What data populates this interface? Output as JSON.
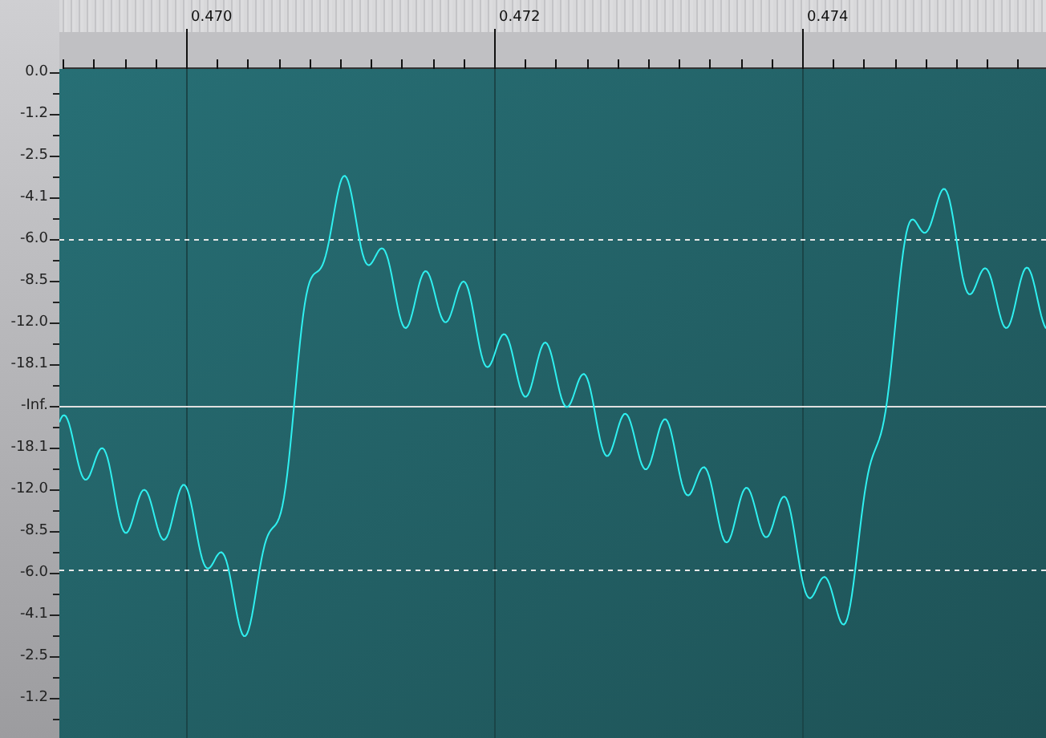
{
  "time_ruler": {
    "labels": [
      "0.470",
      "0.472",
      "0.474"
    ]
  },
  "level_scale": {
    "labels": [
      "0.0",
      "-1.2",
      "-2.5",
      "-4.1",
      "-6.0",
      "-8.5",
      "-12.0",
      "-18.1",
      "-Inf.",
      "-18.1",
      "-12.0",
      "-8.5",
      "-6.0",
      "-4.1",
      "-2.5",
      "-1.2"
    ]
  }
}
